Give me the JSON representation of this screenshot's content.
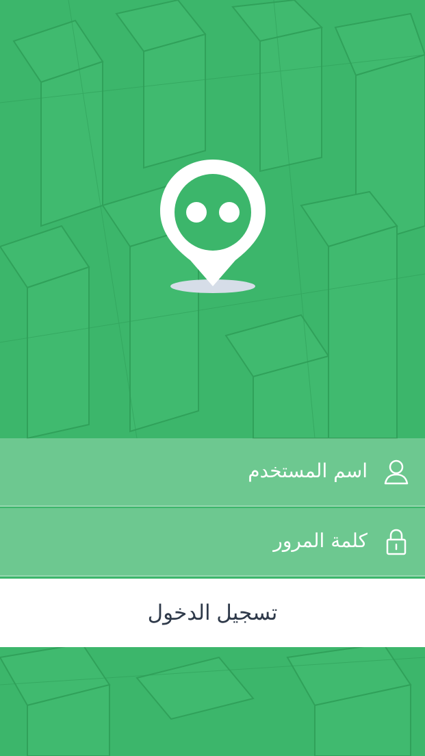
{
  "login": {
    "username_placeholder": "اسم المستخدم",
    "password_placeholder": "كلمة المرور",
    "submit_label": "تسجيل الدخول"
  },
  "icons": {
    "logo": "location-pin-chat-icon",
    "username": "user-icon",
    "password": "lock-icon"
  },
  "colors": {
    "background": "#3cb66b",
    "button_background": "#ffffff",
    "button_text": "#2f3a4a",
    "field_text": "#ffffff"
  }
}
